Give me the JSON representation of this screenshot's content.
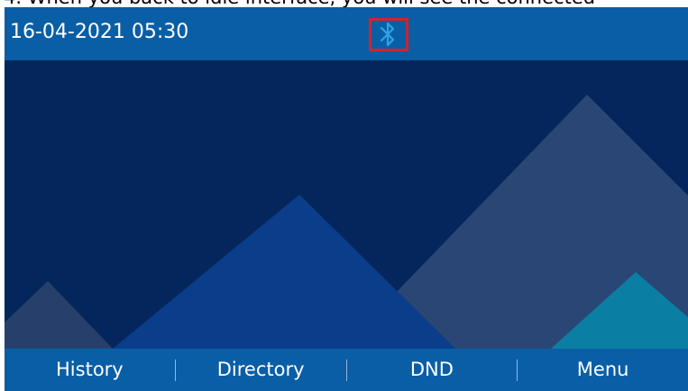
{
  "caption": {
    "text": "4. When you back to idle interface, you will see the connected"
  },
  "status_bar": {
    "datetime": "16-04-2021 05:30",
    "icon": "bluetooth-icon",
    "highlight_color": "#d12330"
  },
  "softkeys": [
    {
      "label": "History"
    },
    {
      "label": "Directory"
    },
    {
      "label": "DND"
    },
    {
      "label": "Menu"
    }
  ],
  "colors": {
    "bar_blue": "#0a5ea6",
    "screen_navy": "#05265c",
    "bluetooth_icon": "#2ea3e6"
  }
}
